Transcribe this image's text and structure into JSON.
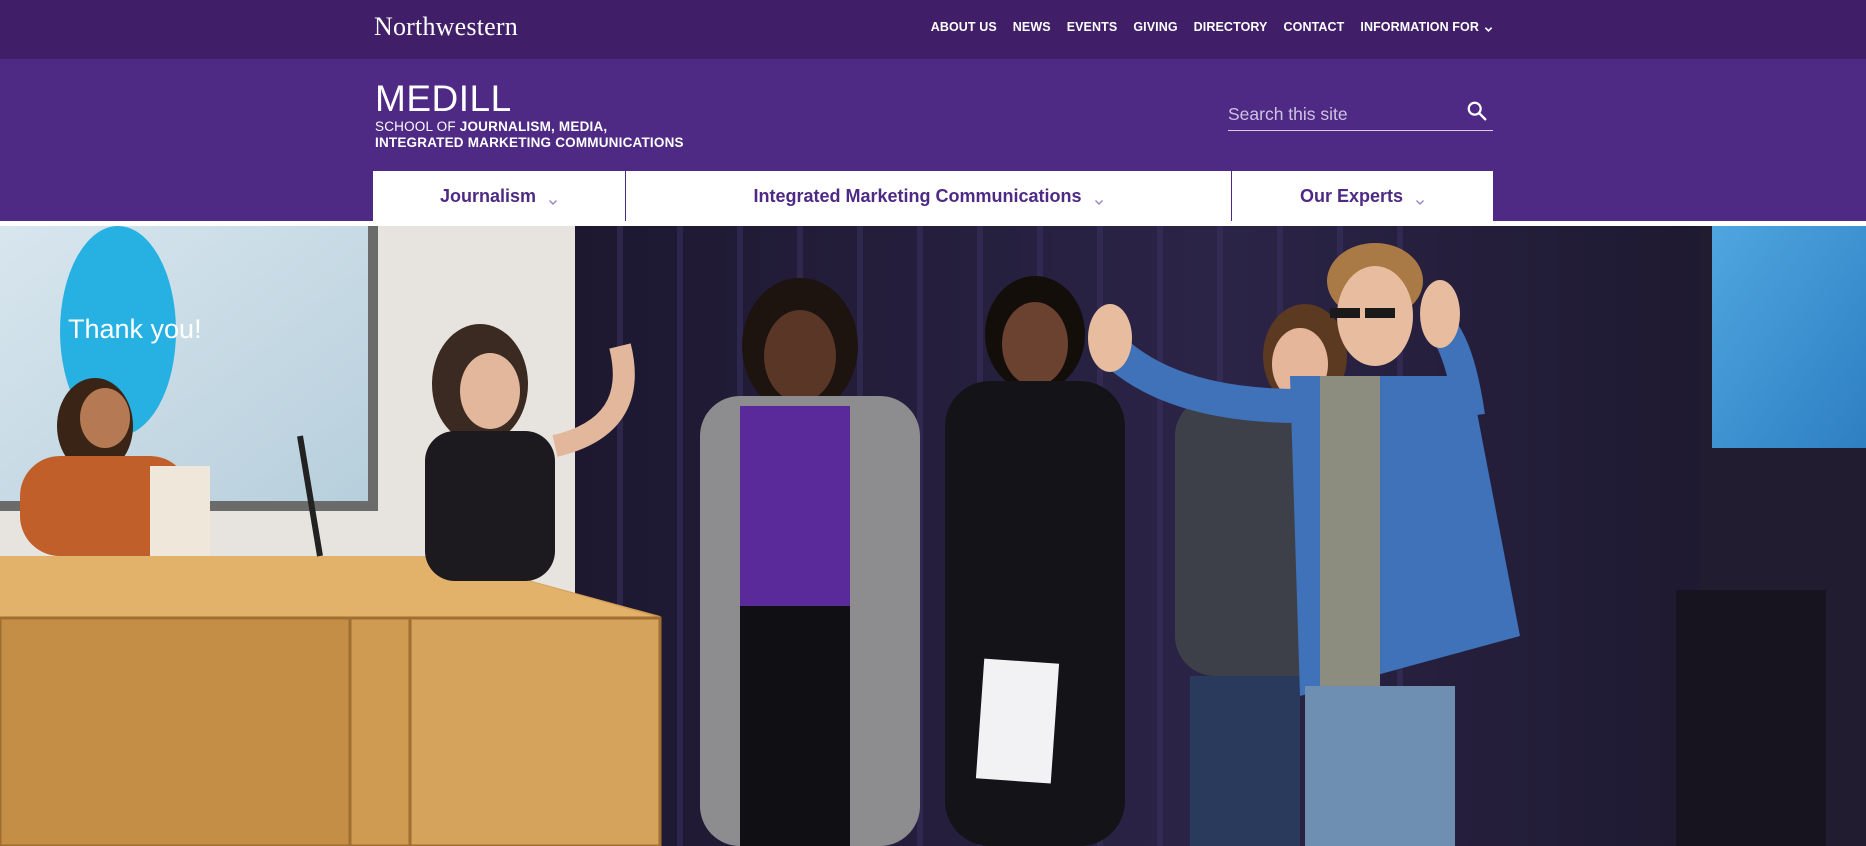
{
  "topbar": {
    "logo_text": "Northwestern",
    "nav": [
      {
        "label": "ABOUT US"
      },
      {
        "label": "NEWS"
      },
      {
        "label": "EVENTS"
      },
      {
        "label": "GIVING"
      },
      {
        "label": "DIRECTORY"
      },
      {
        "label": "CONTACT"
      },
      {
        "label": "INFORMATION FOR",
        "icon": "chevron-down-icon"
      }
    ]
  },
  "header": {
    "title": "MEDILL",
    "subtitle_light": "SCHOOL OF ",
    "subtitle_bold": "JOURNALISM, MEDIA,",
    "subtitle_line2": "INTEGRATED MARKETING COMMUNICATIONS",
    "search": {
      "placeholder": "Search this site",
      "value": "",
      "icon": "search-icon"
    }
  },
  "main_nav": [
    {
      "label": "Journalism",
      "icon": "chevron-down-icon"
    },
    {
      "label": "Integrated Marketing Communications",
      "icon": "chevron-down-icon"
    },
    {
      "label": "Our Experts",
      "icon": "chevron-down-icon"
    }
  ],
  "hero": {
    "screen_text": "Thank you!"
  },
  "colors": {
    "topbar_bg": "#401f68",
    "header_bg": "#4e2a84",
    "nav_text": "#4e2a84",
    "white": "#ffffff"
  }
}
